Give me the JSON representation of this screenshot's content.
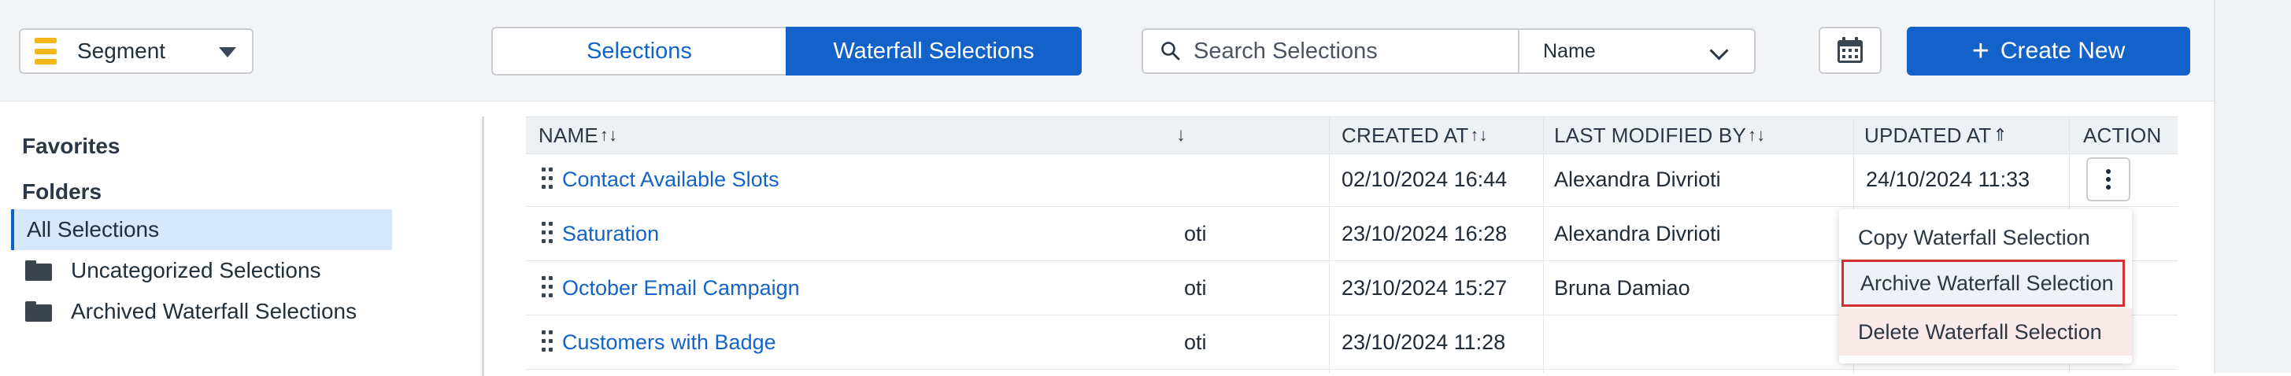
{
  "toolbar": {
    "segment_label": "Segment",
    "tabs": [
      "Selections",
      "Waterfall Selections"
    ],
    "active_tab": "Waterfall Selections",
    "search_placeholder": "Search Selections",
    "sort_field": "Name",
    "create_label": "Create New"
  },
  "sidebar": {
    "favorites": "Favorites",
    "folders": "Folders",
    "items": [
      "All Selections",
      "Uncategorized Selections",
      "Archived Waterfall Selections"
    ]
  },
  "table": {
    "headers": {
      "name": "NAME",
      "col2": "",
      "created": "CREATED AT",
      "modified_by": "LAST MODIFIED BY",
      "updated": "UPDATED AT",
      "action": "ACTION"
    },
    "rows": [
      {
        "name": "Contact Available Slots",
        "col2": "",
        "created": "02/10/2024 16:44",
        "modified_by": "Alexandra Divrioti",
        "updated": "24/10/2024 11:33"
      },
      {
        "name": "Saturation",
        "col2": "oti",
        "created": "23/10/2024 16:28",
        "modified_by": "Alexandra Divrioti",
        "updated": ""
      },
      {
        "name": "October Email Campaign",
        "col2": "oti",
        "created": "23/10/2024 15:27",
        "modified_by": "Bruna Damiao",
        "updated": ""
      },
      {
        "name": "Customers with Badge",
        "col2": "oti",
        "created": "23/10/2024 11:28",
        "modified_by": "",
        "updated": ""
      }
    ]
  },
  "menu": {
    "items": [
      "Copy Waterfall Selection",
      "Archive Waterfall Selection",
      "Delete Waterfall Selection"
    ]
  },
  "colors": {
    "primary": "#1362c9",
    "link": "#1464c8",
    "selected_bg": "#d6e8fb",
    "segment_icon": "#f2b61a",
    "focus_border": "#d32f2f"
  }
}
